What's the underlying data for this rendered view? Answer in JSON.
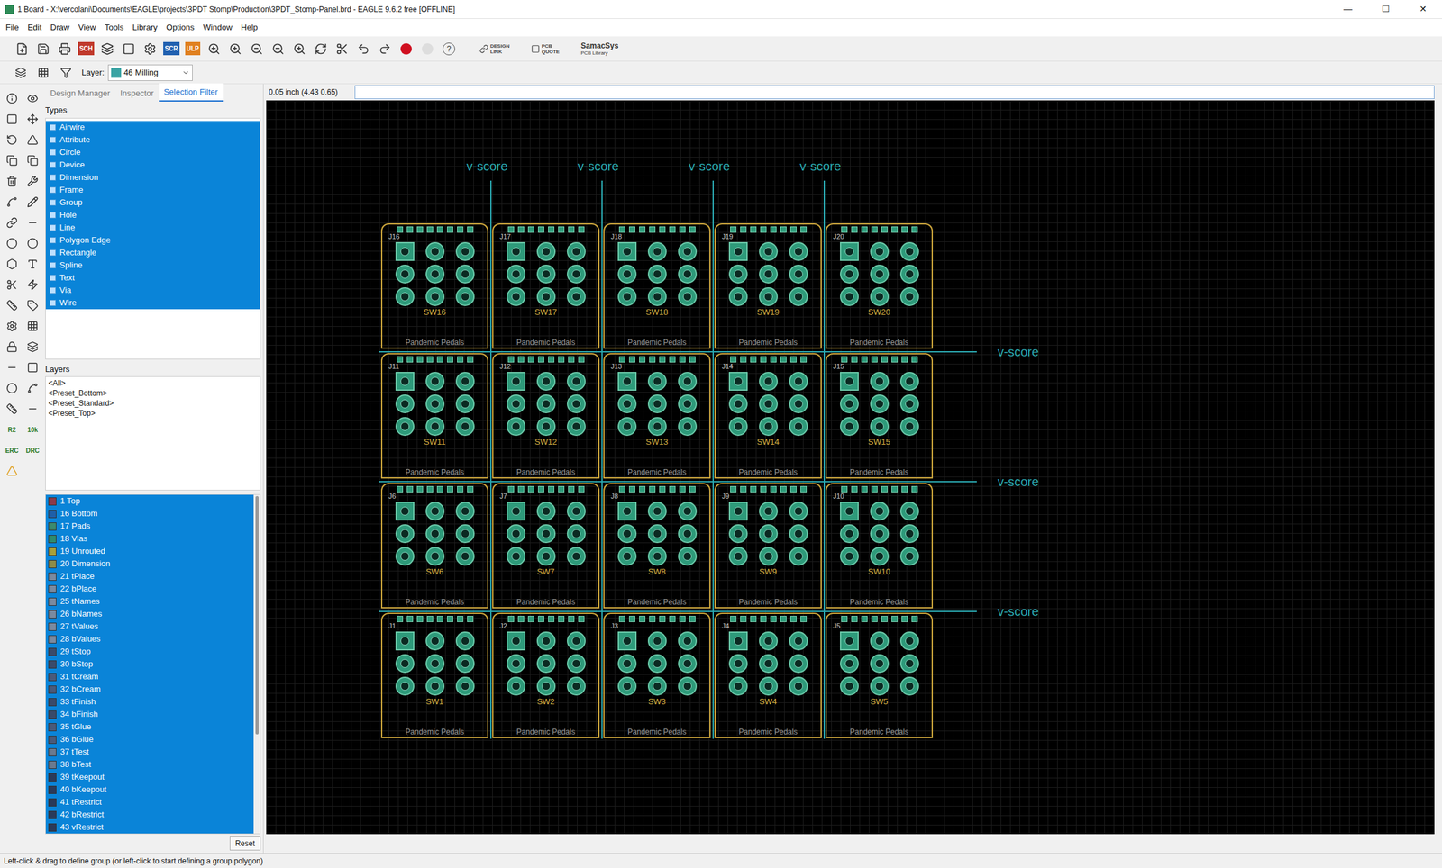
{
  "window": {
    "title": "1 Board - X:\\vercolani\\Documents\\EAGLE\\projects\\3PDT Stomp\\Production\\3PDT_Stomp-Panel.brd - EAGLE 9.6.2 free [OFFLINE]",
    "controls": [
      "—",
      "☐",
      "✕"
    ]
  },
  "menu": [
    "File",
    "Edit",
    "Draw",
    "View",
    "Tools",
    "Library",
    "Options",
    "Window",
    "Help"
  ],
  "toolbar": {
    "labels": [
      "SCH",
      "SCR",
      "ULP",
      "?"
    ],
    "design_link": [
      "DESIGN",
      "LINK"
    ],
    "pcb_quote": [
      "PCB",
      "QUOTE"
    ],
    "samacsys": [
      "SamacSys",
      "PCB Library"
    ]
  },
  "layer_bar": {
    "label": "Layer:",
    "value": "46 Milling",
    "color": "#3aa3a3"
  },
  "tabs": [
    {
      "label": "Design Manager",
      "selected": false
    },
    {
      "label": "Inspector",
      "selected": false
    },
    {
      "label": "Selection Filter",
      "selected": true
    }
  ],
  "types_header": "Types",
  "types": [
    {
      "label": "Airwire",
      "selected": true
    },
    {
      "label": "Attribute",
      "selected": true
    },
    {
      "label": "Circle",
      "selected": true
    },
    {
      "label": "Device",
      "selected": true
    },
    {
      "label": "Dimension",
      "selected": true
    },
    {
      "label": "Frame",
      "selected": true
    },
    {
      "label": "Group",
      "selected": true
    },
    {
      "label": "Hole",
      "selected": true
    },
    {
      "label": "Line",
      "selected": true
    },
    {
      "label": "Polygon Edge",
      "selected": true
    },
    {
      "label": "Rectangle",
      "selected": true
    },
    {
      "label": "Spline",
      "selected": true
    },
    {
      "label": "Text",
      "selected": true
    },
    {
      "label": "Via",
      "selected": true
    },
    {
      "label": "Wire",
      "selected": true
    }
  ],
  "layers_header": "Layers",
  "presets": [
    "<All>",
    "<Preset_Bottom>",
    "<Preset_Standard>",
    "<Preset_Top>"
  ],
  "layers": [
    {
      "label": "1 Top",
      "color": "#8b3a4a",
      "selected": true
    },
    {
      "label": "16 Bottom",
      "color": "#1f5fa8",
      "selected": true
    },
    {
      "label": "17 Pads",
      "color": "#3b8a6e",
      "selected": true
    },
    {
      "label": "18 Vias",
      "color": "#2e8b6e",
      "selected": true
    },
    {
      "label": "19 Unrouted",
      "color": "#a8a03a",
      "selected": true
    },
    {
      "label": "20 Dimension",
      "color": "#8c8c4a",
      "selected": true
    },
    {
      "label": "21 tPlace",
      "color": "#7a8aa0",
      "selected": true
    },
    {
      "label": "22 bPlace",
      "color": "#7a8aa0",
      "selected": true
    },
    {
      "label": "25 tNames",
      "color": "#7a8aa0",
      "selected": true
    },
    {
      "label": "26 bNames",
      "color": "#7a8aa0",
      "selected": true
    },
    {
      "label": "27 tValues",
      "color": "#7a8aa0",
      "selected": true
    },
    {
      "label": "28 bValues",
      "color": "#7a8aa0",
      "selected": true
    },
    {
      "label": "29 tStop",
      "color": "#3a4a6a",
      "selected": true
    },
    {
      "label": "30 bStop",
      "color": "#3a4a6a",
      "selected": true
    },
    {
      "label": "31 tCream",
      "color": "#4a5a7a",
      "selected": true
    },
    {
      "label": "32 bCream",
      "color": "#4a5a7a",
      "selected": true
    },
    {
      "label": "33 tFinish",
      "color": "#3a4a6a",
      "selected": true
    },
    {
      "label": "34 bFinish",
      "color": "#3a4a6a",
      "selected": true
    },
    {
      "label": "35 tGlue",
      "color": "#4a5a7a",
      "selected": true
    },
    {
      "label": "36 bGlue",
      "color": "#4a5a7a",
      "selected": true
    },
    {
      "label": "37 tTest",
      "color": "#6a7a90",
      "selected": true
    },
    {
      "label": "38 bTest",
      "color": "#6a7a90",
      "selected": true
    },
    {
      "label": "39 tKeepout",
      "color": "#2a3a5a",
      "selected": true
    },
    {
      "label": "40 bKeepout",
      "color": "#2a3a5a",
      "selected": true
    },
    {
      "label": "41 tRestrict",
      "color": "#2a3a5a",
      "selected": true
    },
    {
      "label": "42 bRestrict",
      "color": "#2a3a5a",
      "selected": true
    },
    {
      "label": "43 vRestrict",
      "color": "#2a3a5a",
      "selected": true
    }
  ],
  "reset": "Reset",
  "tool_labels": [
    "R2",
    "10k",
    "ERC",
    "DRC"
  ],
  "coordinates": "0.05 inch (4.43 0.65)",
  "command": "",
  "canvas": {
    "vscore_label": "v-score",
    "vertical_scores": 4,
    "horizontal_scores": 3,
    "boards": [
      {
        "sw": "SW16",
        "header": "J16"
      },
      {
        "sw": "SW17",
        "header": "J17"
      },
      {
        "sw": "SW18",
        "header": "J18"
      },
      {
        "sw": "SW19",
        "header": "J19"
      },
      {
        "sw": "SW20",
        "header": "J20"
      },
      {
        "sw": "SW11",
        "header": "J11"
      },
      {
        "sw": "SW12",
        "header": "J12"
      },
      {
        "sw": "SW13",
        "header": "J13"
      },
      {
        "sw": "SW14",
        "header": "J14"
      },
      {
        "sw": "SW15",
        "header": "J15"
      },
      {
        "sw": "SW6",
        "header": "J6"
      },
      {
        "sw": "SW7",
        "header": "J7"
      },
      {
        "sw": "SW8",
        "header": "J8"
      },
      {
        "sw": "SW9",
        "header": "J9"
      },
      {
        "sw": "SW10",
        "header": "J10"
      },
      {
        "sw": "SW1",
        "header": "J1"
      },
      {
        "sw": "SW2",
        "header": "J2"
      },
      {
        "sw": "SW3",
        "header": "J3"
      },
      {
        "sw": "SW4",
        "header": "J4"
      },
      {
        "sw": "SW5",
        "header": "J5"
      }
    ],
    "brand": "Pandemic Pedals"
  },
  "status_bar": "Left-click & drag to define group (or left-click to start defining a group polygon)"
}
